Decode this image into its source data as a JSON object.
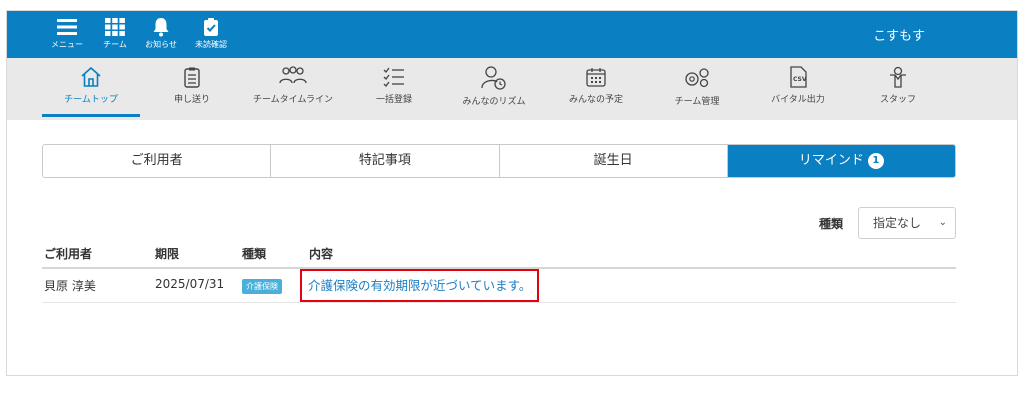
{
  "topbar": {
    "items": [
      {
        "label": "メニュー",
        "icon": "menu-icon"
      },
      {
        "label": "チーム",
        "icon": "grid-icon"
      },
      {
        "label": "お知らせ",
        "icon": "bell-icon"
      },
      {
        "label": "未読確認",
        "icon": "clipboard-check-icon"
      }
    ],
    "user_name": "こすもす",
    "color": "#0a7fc1"
  },
  "nav": {
    "items": [
      {
        "label": "チームトップ",
        "icon": "home-icon",
        "active": true
      },
      {
        "label": "申し送り",
        "icon": "clipboard-list-icon"
      },
      {
        "label": "チームタイムライン",
        "icon": "people-icon"
      },
      {
        "label": "一括登録",
        "icon": "checklist-icon"
      },
      {
        "label": "みんなのリズム",
        "icon": "person-clock-icon"
      },
      {
        "label": "みんなの予定",
        "icon": "calendar-icon"
      },
      {
        "label": "チーム管理",
        "icon": "gears-icon"
      },
      {
        "label": "バイタル出力",
        "icon": "csv-file-icon"
      },
      {
        "label": "スタッフ",
        "icon": "staff-icon"
      }
    ]
  },
  "tabs": [
    {
      "label": "ご利用者"
    },
    {
      "label": "特記事項"
    },
    {
      "label": "誕生日"
    },
    {
      "label": "リマインド",
      "badge": "1",
      "active": true
    }
  ],
  "filter": {
    "label": "種類",
    "selected": "指定なし"
  },
  "table": {
    "headers": [
      "ご利用者",
      "期限",
      "種類",
      "内容"
    ],
    "rows": [
      {
        "user": "貝原 淳美",
        "deadline": "2025/07/31",
        "type": "介護保険",
        "content": "介護保険の有効期限が近づいています。"
      }
    ]
  },
  "colors": {
    "accent": "#0a7fc1",
    "tag": "#4ab0d9",
    "highlight_border": "#e3000f",
    "link": "#1b7fc4"
  }
}
